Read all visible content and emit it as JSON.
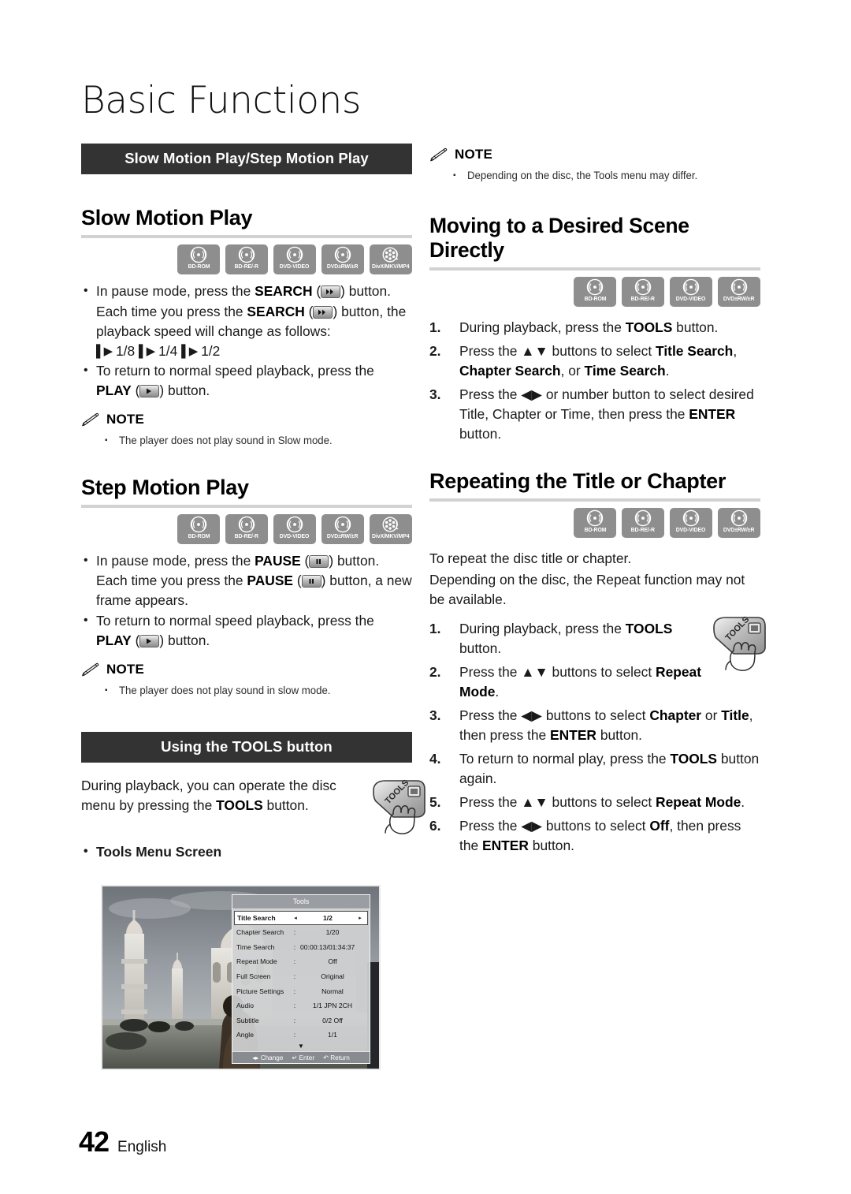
{
  "document": {
    "chapter_title": "Basic Functions",
    "page_number": "42",
    "language": "English"
  },
  "icons": {
    "bd_rom": "BD-ROM",
    "bd_re_r": "BD-RE/-R",
    "dvd_video": "DVD-VIDEO",
    "dvd_rw_r": "DVD±RW/±R",
    "divx": "DivX/MKV/MP4"
  },
  "left_column": {
    "section_bar": "Slow Motion Play/Step Motion Play",
    "slow_motion": {
      "heading": "Slow Motion Play",
      "discs": [
        "BD-ROM",
        "BD-RE/-R",
        "DVD-VIDEO",
        "DVD±RW/±R",
        "DivX/MKV/MP4"
      ],
      "bullet1_a": "In pause mode, press the ",
      "bullet1_search": "SEARCH",
      "bullet1_b": " button.",
      "para_a": "Each time you press the ",
      "para_search": "SEARCH",
      "para_b": " button, the playback speed will change as follows:",
      "speeds": [
        "1/8",
        "1/4",
        "1/2"
      ],
      "bullet2_a": "To return to normal speed playback, press the ",
      "bullet2_play": "PLAY",
      "bullet2_b": " button.",
      "note_label": "NOTE",
      "note_text": "The player does not play sound in Slow mode."
    },
    "step_motion": {
      "heading": "Step Motion Play",
      "discs": [
        "BD-ROM",
        "BD-RE/-R",
        "DVD-VIDEO",
        "DVD±RW/±R",
        "DivX/MKV/MP4"
      ],
      "bullet1_a": "In pause mode, press the ",
      "bullet1_pause": "PAUSE",
      "bullet1_b": " button.",
      "para_a": "Each time you press the ",
      "para_pause": "PAUSE",
      "para_b": " button, a new frame appears.",
      "bullet2_a": "To return to normal speed playback, press the ",
      "bullet2_play": "PLAY",
      "bullet2_b": " button.",
      "note_label": "NOTE",
      "note_text": "The player does not play sound in slow mode."
    },
    "tools_section": {
      "section_bar": "Using the TOOLS button",
      "intro_a": "During playback, you can operate the disc menu by pressing the ",
      "intro_tools": "TOOLS",
      "intro_b": " button.",
      "remote_label": "TOOLS",
      "subhead": "Tools Menu Screen"
    }
  },
  "tools_menu_screenshot": {
    "title": "Tools",
    "rows": [
      {
        "label": "Title Search",
        "sep": ":",
        "value": "1/2",
        "selected": true
      },
      {
        "label": "Chapter Search",
        "sep": ":",
        "value": "1/20",
        "selected": false
      },
      {
        "label": "Time Search",
        "sep": ":",
        "value": "00:00:13/01:34:37",
        "selected": false
      },
      {
        "label": "Repeat Mode",
        "sep": ":",
        "value": "Off",
        "selected": false
      },
      {
        "label": "Full Screen",
        "sep": ":",
        "value": "Original",
        "selected": false
      },
      {
        "label": "Picture Settings",
        "sep": ":",
        "value": "Normal",
        "selected": false
      },
      {
        "label": "Audio",
        "sep": ":",
        "value": "1/1 JPN 2CH",
        "selected": false
      },
      {
        "label": "Subtitle",
        "sep": ":",
        "value": "0/2 Off",
        "selected": false
      },
      {
        "label": "Angle",
        "sep": ":",
        "value": "1/1",
        "selected": false
      }
    ],
    "scroll_down": "▼",
    "footer": {
      "change": "Change",
      "enter": "Enter",
      "return": "Return"
    }
  },
  "right_column": {
    "top_note": {
      "note_label": "NOTE",
      "note_text": "Depending on the disc, the Tools menu may differ."
    },
    "moving_scene": {
      "heading": "Moving to a Desired Scene Directly",
      "discs": [
        "BD-ROM",
        "BD-RE/-R",
        "DVD-VIDEO",
        "DVD±RW/±R"
      ],
      "steps": [
        {
          "n": "1.",
          "a": "During playback, press the ",
          "b": "TOOLS",
          "c": " button."
        },
        {
          "n": "2.",
          "a": "Press the ▲▼ buttons to select ",
          "b": "Title Search",
          "c": ", ",
          "d": "Chapter Search",
          "e": ", or ",
          "f": "Time Search",
          "g": "."
        },
        {
          "n": "3.",
          "a": "Press the ◀▶ or number button to select desired Title, Chapter or Time, then press the ",
          "b": "ENTER",
          "c": " button."
        }
      ]
    },
    "repeating": {
      "heading": "Repeating the Title or Chapter",
      "discs": [
        "BD-ROM",
        "BD-RE/-R",
        "DVD-VIDEO",
        "DVD±RW/±R"
      ],
      "intro1": "To repeat the disc title or chapter.",
      "intro2": "Depending on the disc, the Repeat function may not be available.",
      "remote_label": "TOOLS",
      "steps": [
        {
          "n": "1.",
          "a": "During playback, press the ",
          "b": "TOOLS",
          "c": " button."
        },
        {
          "n": "2.",
          "a": "Press the ▲▼ buttons to select ",
          "b": "Repeat Mode",
          "c": "."
        },
        {
          "n": "3.",
          "a": "Press the ◀▶ buttons to select ",
          "b": "Chapter",
          "c": " or ",
          "d": "Title",
          "e": ", then press the ",
          "f": "ENTER",
          "g": " button."
        },
        {
          "n": "4.",
          "a": "To return to normal play, press the ",
          "b": "TOOLS",
          "c": " button again."
        },
        {
          "n": "5.",
          "a": "Press the ▲▼ buttons to select ",
          "b": "Repeat Mode",
          "c": "."
        },
        {
          "n": "6.",
          "a": "Press the ◀▶ buttons to select ",
          "b": "Off",
          "c": ", then press the ",
          "d": "ENTER",
          "e": " button."
        }
      ]
    }
  },
  "colors": {
    "bar_background": "#333333",
    "rule": "#d2d2d2",
    "disc_badge": "#8e8e8e"
  }
}
